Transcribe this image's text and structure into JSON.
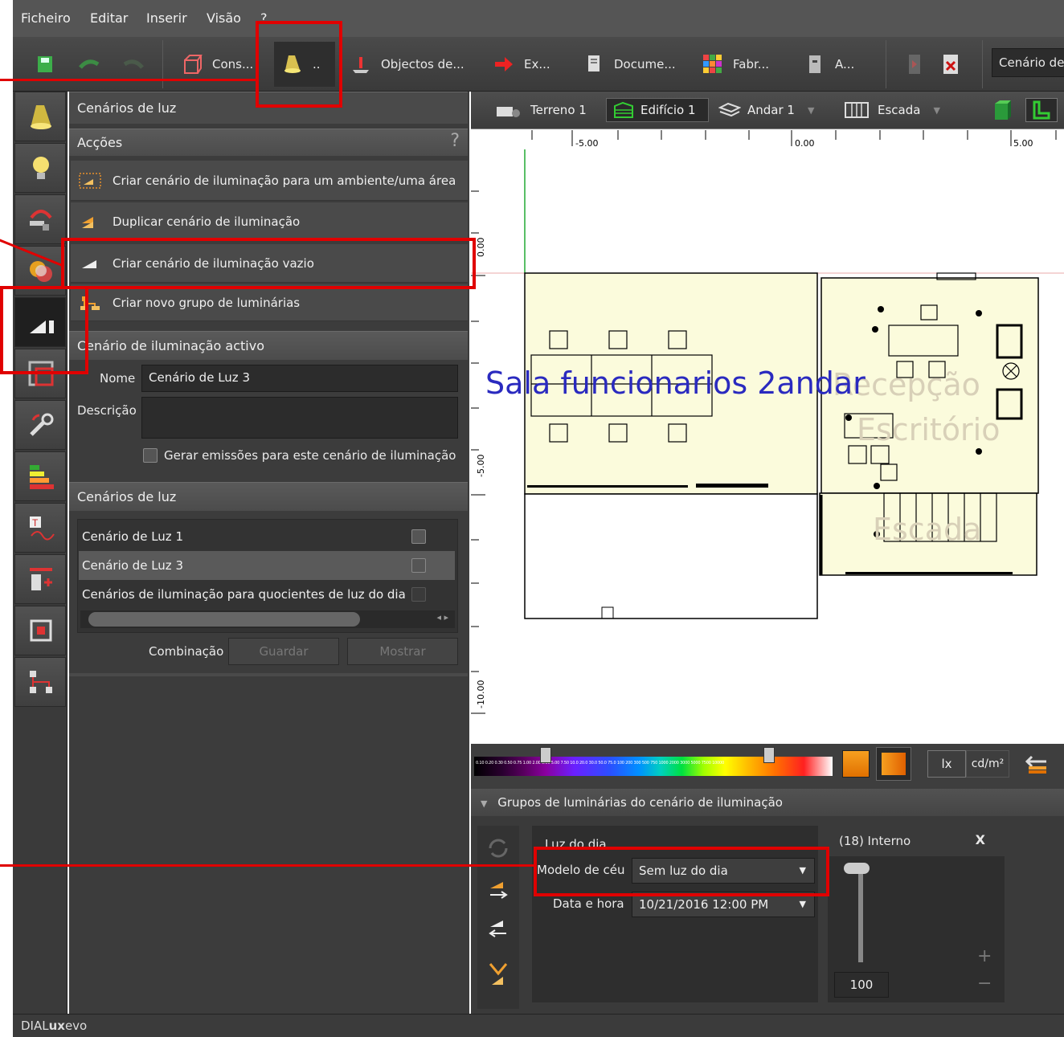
{
  "menu": [
    "Ficheiro",
    "Editar",
    "Inserir",
    "Visão",
    "?"
  ],
  "toolbar": {
    "construct": "Cons...",
    "light": "..",
    "objects": "Objectos de...",
    "export": "Ex...",
    "documents": "Docume...",
    "manufacturers": "Fabr...",
    "a": "A...",
    "scenario": "Cenário de"
  },
  "panel": {
    "title": "Cenários de luz",
    "actions_head": "Acções",
    "help": "?",
    "actions": [
      "Criar cenário de iluminação para um ambiente/uma área",
      "Duplicar cenário de iluminação",
      "Criar cenário de iluminação vazio",
      "Criar novo grupo de luminárias"
    ],
    "active_head": "Cenário de iluminação activo",
    "name_label": "Nome",
    "name_value": "Cenário de Luz 3",
    "desc_label": "Descrição",
    "emissions_label": "Gerar emissões para este cenário de iluminação",
    "scenes_head": "Cenários de luz",
    "scenes": [
      "Cenário de Luz 1",
      "Cenário de Luz 3",
      "Cenários de iluminação para quocientes de luz do dia"
    ],
    "combination_label": "Combinação",
    "save": "Guardar",
    "show": "Mostrar"
  },
  "viewport": {
    "terrain": "Terreno 1",
    "building": "Edifício 1",
    "floor": "Andar 1",
    "stair": "Escada",
    "ruler_top": [
      "-5.00",
      "0.00",
      "5.00"
    ],
    "ruler_left": [
      "0.00",
      "-5.00",
      "-10.00"
    ],
    "rooms": {
      "sala": "Sala funcionarios 2andar",
      "recepcao": "Recepção",
      "escritorio": "Escritório",
      "escada": "Escada"
    }
  },
  "scale": {
    "labels": "0.10 0.20 0.30 0.50 0.75 1.00 2.00 3.00 5.00 7.50 10.0 20.0 30.0 50.0 75.0 100 200 300 500 750 1000 2000 3000 5000 7500 10000",
    "unit_lx": "lx",
    "unit_cd": "cd/m²"
  },
  "groups": {
    "title": "Grupos de luminárias do cenário de iluminação",
    "daylight_title": "Luz do dia",
    "sky_model_label": "Modelo de céu",
    "sky_model_value": "Sem luz do dia",
    "datetime_label": "Data e hora",
    "datetime_value": "10/21/2016 12:00 PM",
    "internal_title": "(18)  Interno",
    "close": "X",
    "dimmer_value": "100",
    "plus": "+",
    "minus": "−"
  },
  "status": {
    "brand_a": "DIAL",
    "brand_b": "ux",
    "brand_c": "evo"
  },
  "colors": {
    "highlight": "#e00000",
    "room_fill": "#fbfbdc",
    "accent_green": "#22aa33"
  }
}
